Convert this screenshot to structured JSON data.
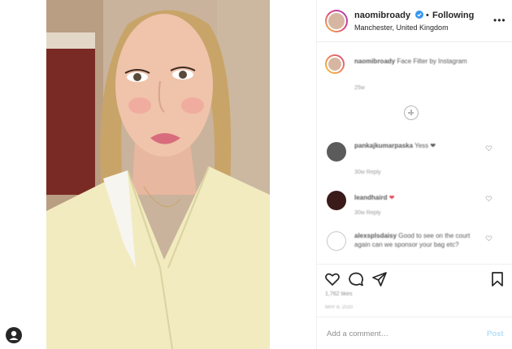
{
  "header": {
    "username": "naomibroady",
    "separator": "•",
    "follow_label": "Following",
    "location": "Manchester, United Kingdom",
    "more_label": "•••"
  },
  "comments": [
    {
      "user": "naomibroady",
      "text": "Face Filter by Instagram",
      "meta": "25w"
    },
    {
      "user": "pankajkumarpaska",
      "text": "Yess ❤",
      "meta": "30w  Reply"
    },
    {
      "user": "leandhaird",
      "text": "❤",
      "meta": "30w  Reply"
    },
    {
      "user": "alexsplsdaisy",
      "text": "Good to see on the court again can we sponsor your bag etc?",
      "meta": ""
    }
  ],
  "likes": "1,762 likes",
  "date": "MAY 8, 2020",
  "add_comment": {
    "placeholder": "Add a comment…",
    "post_label": "Post"
  },
  "colors": {
    "verified": "#3897f0",
    "post_disabled": "#b2dffc",
    "border": "#efefef"
  }
}
